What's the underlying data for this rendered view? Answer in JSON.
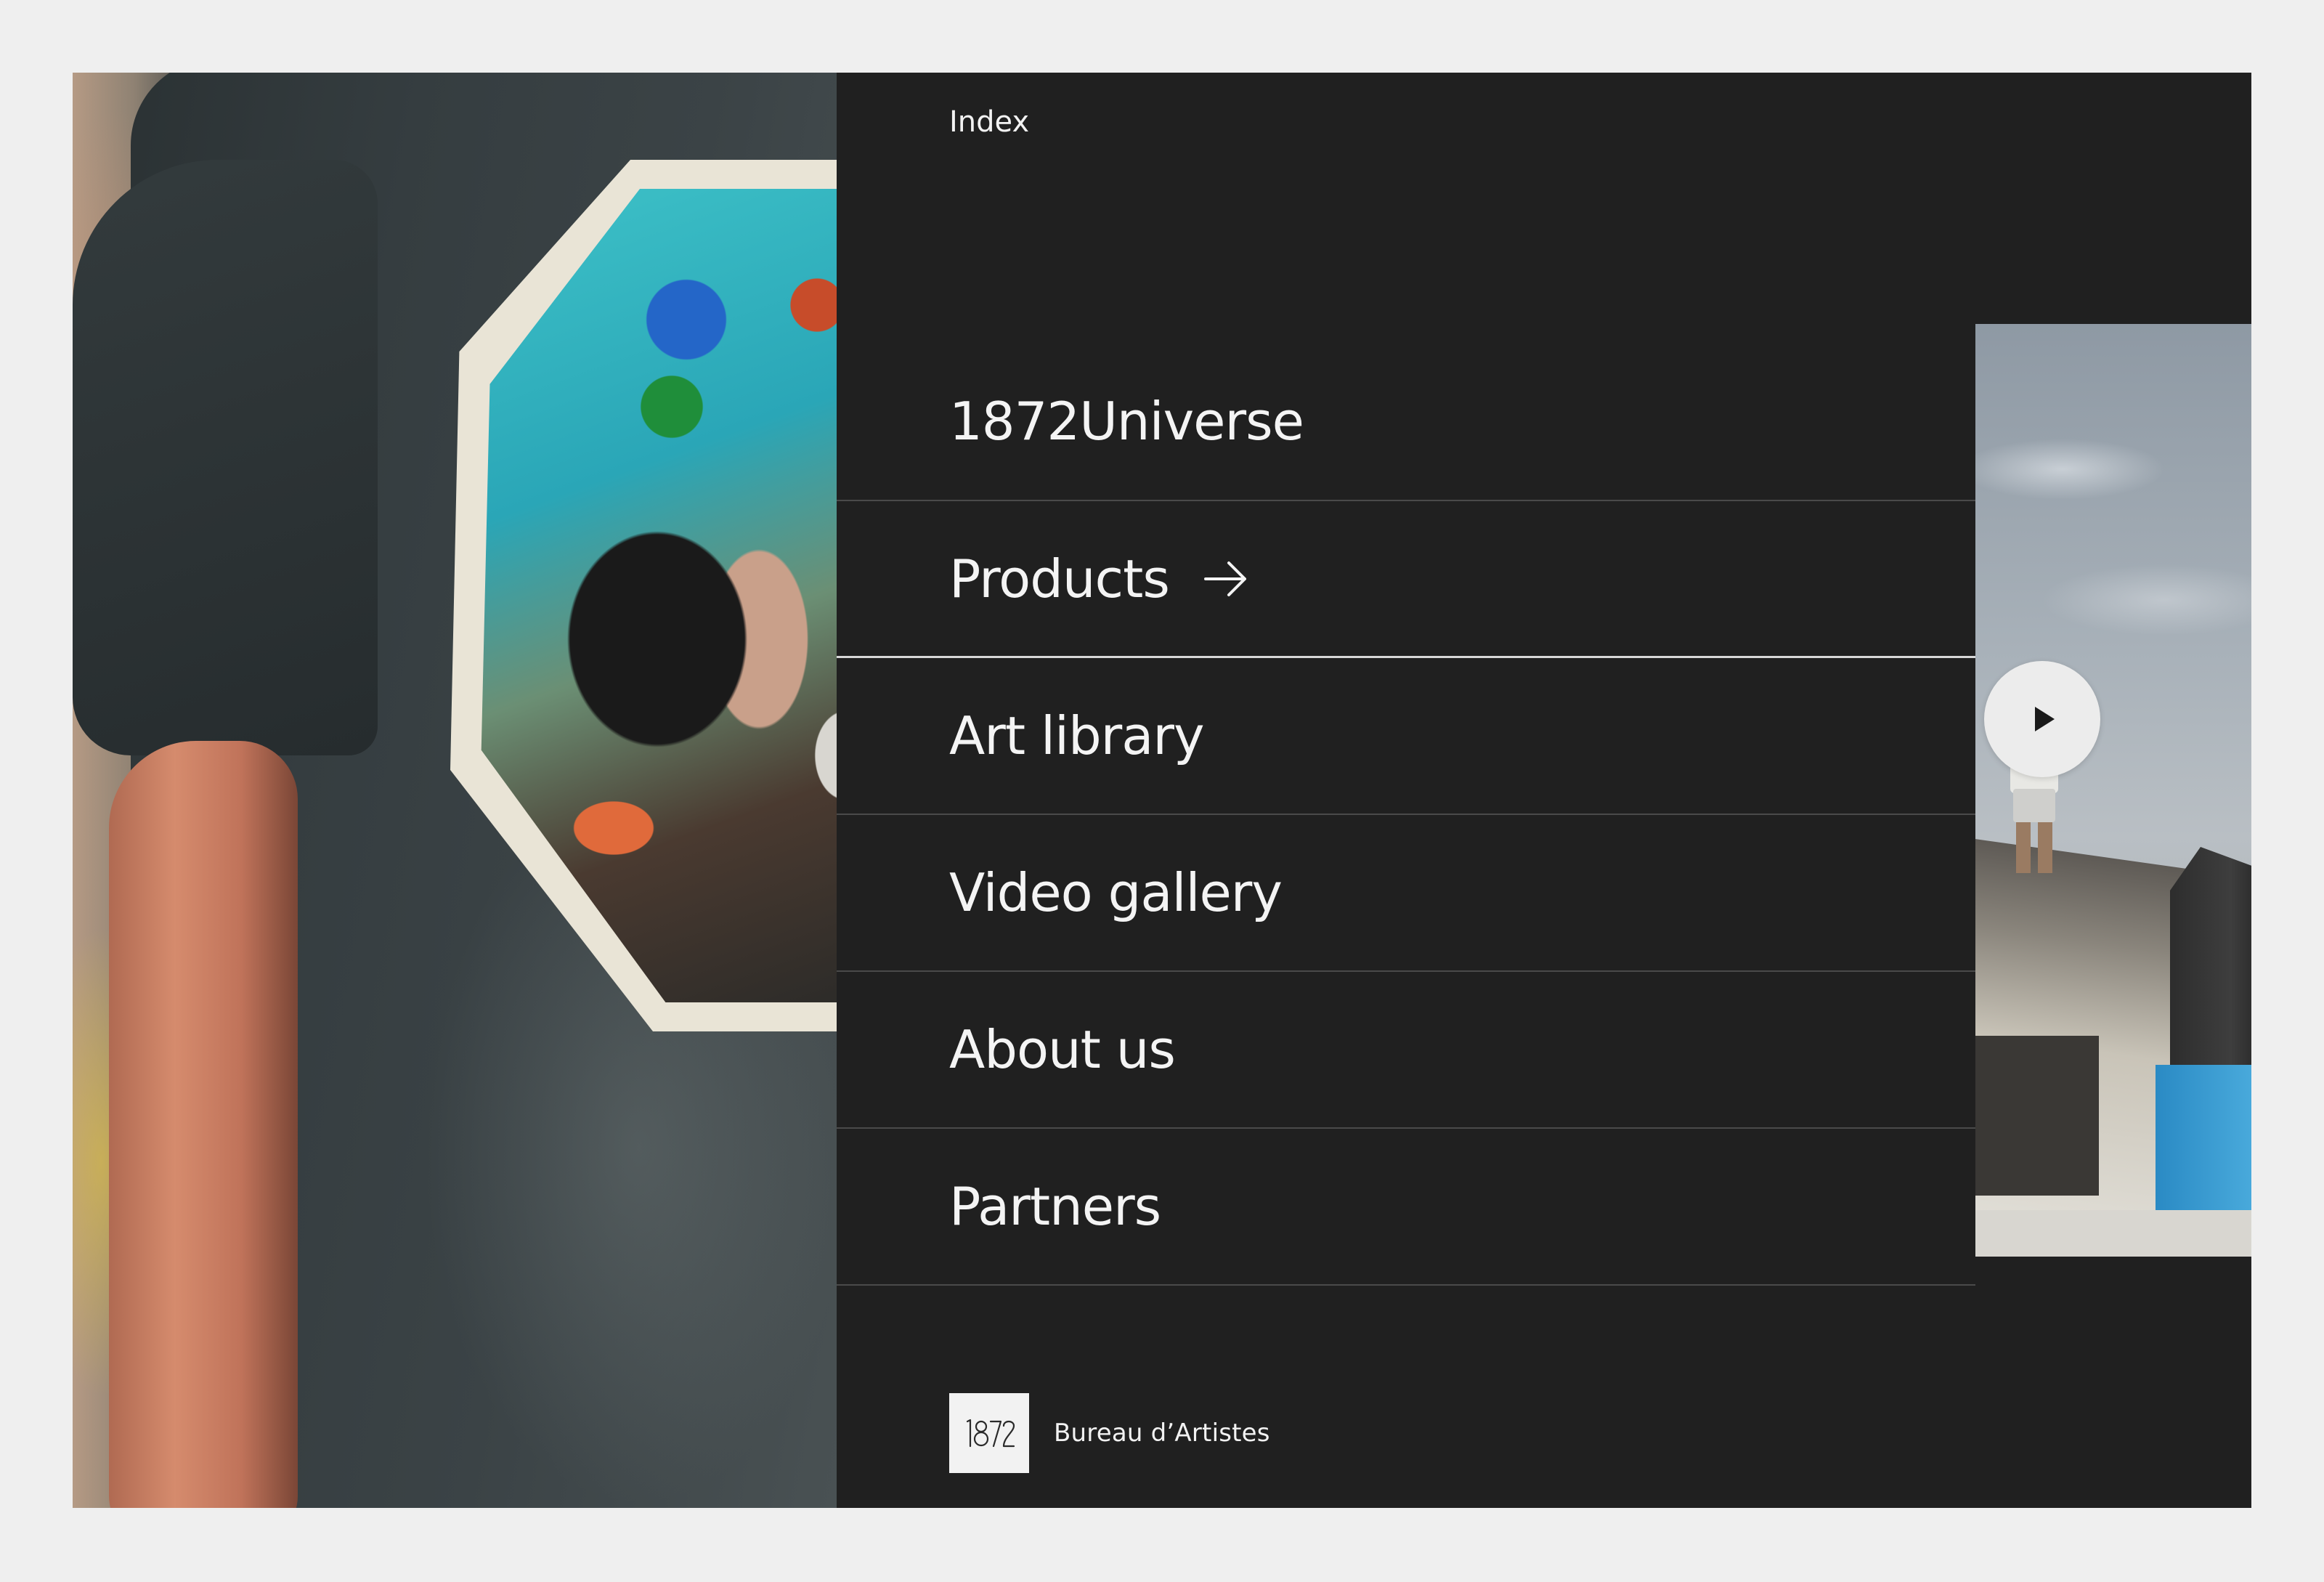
{
  "header": {
    "index_label": "Index"
  },
  "menu": {
    "items": [
      {
        "label": "1872Universe"
      },
      {
        "label": "Products"
      },
      {
        "label": "Art library"
      },
      {
        "label": "Video gallery"
      },
      {
        "label": "About us"
      },
      {
        "label": "Partners"
      }
    ],
    "active_index": 1
  },
  "brand": {
    "logo_text": "1872",
    "name": "Bureau d’Artistes"
  },
  "icons": {
    "arrow": "arrow-right-icon",
    "play": "play-icon"
  },
  "colors": {
    "page_background": "#efefef",
    "menu_background": "#202020",
    "text": "#f4f4f4",
    "divider": "#4a4a4a",
    "active_divider": "#d8d8d8"
  }
}
